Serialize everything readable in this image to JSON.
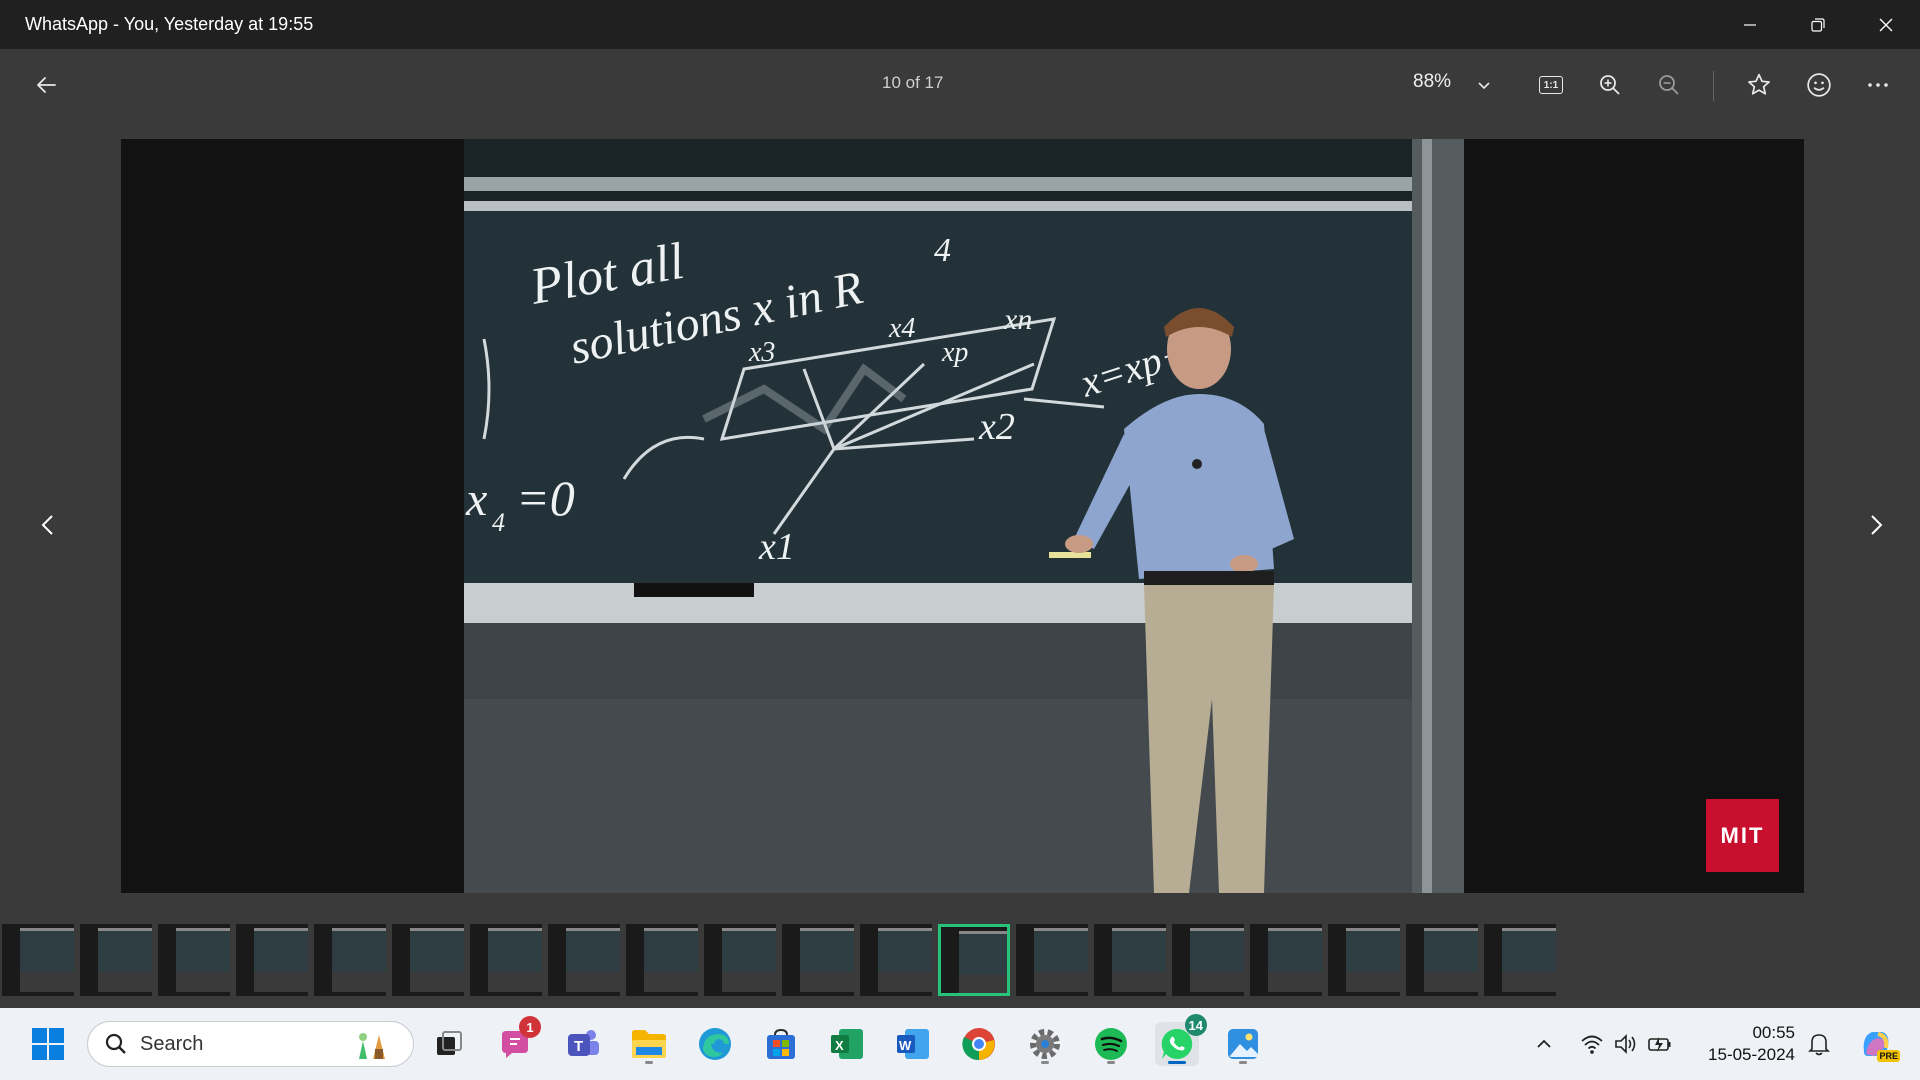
{
  "window": {
    "title": "WhatsApp - You, Yesterday at 19:55"
  },
  "viewer": {
    "counter": "10 of 17",
    "zoom": "88%",
    "actual_size_label": "1:1"
  },
  "image": {
    "board_text": {
      "line1": "Plot all",
      "line2": "solutions x in R",
      "sup": "4",
      "eq_left": "x",
      "eq_left_sub": "4",
      "eq_left_rhs": "=0",
      "xp": "xp",
      "x4": "x4",
      "xn": "xn",
      "x2": "x2",
      "x1": "x1",
      "x3": "x3",
      "eq_right": "x=xp+xn"
    },
    "logo_text": "MIT"
  },
  "filmstrip": {
    "count": 20,
    "active_index": 12
  },
  "taskbar": {
    "search_label": "Search",
    "copilot_badge": "PRE",
    "notification_badges": {
      "app_with_badge": "1",
      "whatsapp": "14"
    },
    "time": "00:55",
    "date": "15-05-2024"
  },
  "colors": {
    "accent_green": "#27c37a",
    "mit_red": "#c8102e",
    "taskbar_bg": "#eef1f5",
    "titlebar_bg": "#202020"
  }
}
